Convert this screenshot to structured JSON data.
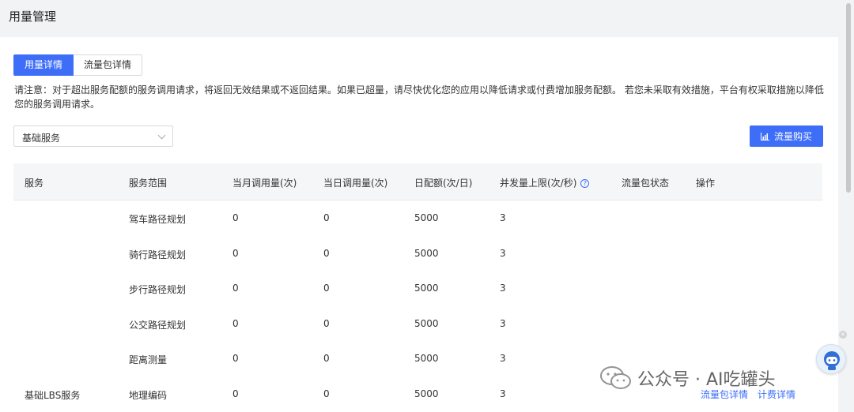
{
  "page": {
    "title": "用量管理"
  },
  "tabs": [
    {
      "label": "用量详情",
      "active": true
    },
    {
      "label": "流量包详情",
      "active": false
    }
  ],
  "notice": "请注意：对于超出服务配额的服务调用请求，将返回无效结果或不返回结果。如果已超量，请尽快优化您的应用以降低请求或付费增加服务配额。 若您未采取有效措施，平台有权采取措施以降低您的服务调用请求。",
  "filter": {
    "selected": "基础服务"
  },
  "buy_button": {
    "label": "流量购买",
    "icon": "bar-chart-icon"
  },
  "table": {
    "headers": {
      "service": "服务",
      "scope": "服务范围",
      "monthly": "当月调用量(次)",
      "daily": "当日调用量(次)",
      "quota": "日配额(次/日)",
      "concurrency": "并发量上限(次/秒)",
      "package_status": "流量包状态",
      "actions": "操作"
    },
    "rows": [
      {
        "service": "",
        "scope": "驾车路径规划",
        "monthly": "0",
        "daily": "0",
        "quota": "5000",
        "concurrency": "3"
      },
      {
        "service": "",
        "scope": "骑行路径规划",
        "monthly": "0",
        "daily": "0",
        "quota": "5000",
        "concurrency": "3"
      },
      {
        "service": "",
        "scope": "步行路径规划",
        "monthly": "0",
        "daily": "0",
        "quota": "5000",
        "concurrency": "3"
      },
      {
        "service": "",
        "scope": "公交路径规划",
        "monthly": "0",
        "daily": "0",
        "quota": "5000",
        "concurrency": "3"
      },
      {
        "service": "",
        "scope": "距离测量",
        "monthly": "0",
        "daily": "0",
        "quota": "5000",
        "concurrency": "3"
      },
      {
        "service": "基础LBS服务",
        "scope": "地理编码",
        "monthly": "0",
        "daily": "0",
        "quota": "5000",
        "concurrency": "3"
      }
    ],
    "action_links": {
      "package_detail": "流量包详情",
      "billing_detail": "计费详情"
    }
  },
  "watermark": {
    "text": "公众号 · AI吃罐头"
  },
  "colors": {
    "accent": "#3e6ef8",
    "background": "#f2f3f5",
    "header_row": "#f5f6f8"
  }
}
